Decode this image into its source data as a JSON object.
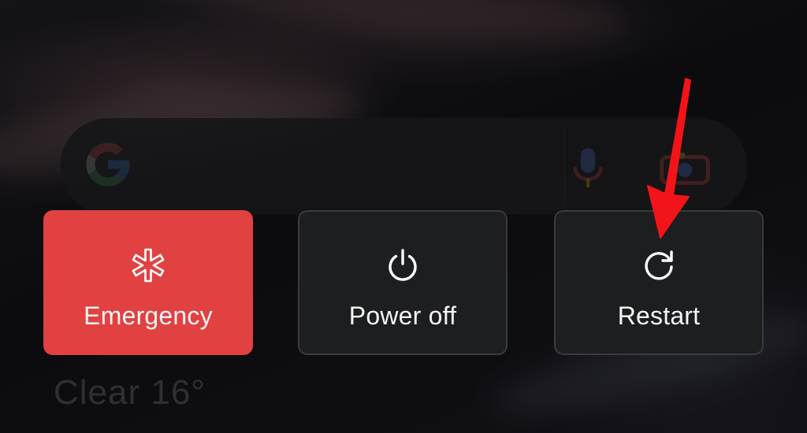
{
  "background": {
    "colors": {
      "base": "#0b0b0d",
      "streak": "#5a4648"
    }
  },
  "search_bar": {
    "logo_icon": "google-g-icon",
    "mic_icon": "microphone-icon",
    "lens_icon": "camera-lens-icon"
  },
  "power_menu": {
    "buttons": [
      {
        "label": "Emergency",
        "icon": "asterisk-medical-icon",
        "color": "#e14141"
      },
      {
        "label": "Power off",
        "icon": "power-icon",
        "color": "#1d1e20"
      },
      {
        "label": "Restart",
        "icon": "restart-icon",
        "color": "#1d1e20"
      }
    ]
  },
  "weather": {
    "text": "Clear 16°"
  },
  "annotation": {
    "arrow_color": "#f21418",
    "points_to": "Restart"
  }
}
